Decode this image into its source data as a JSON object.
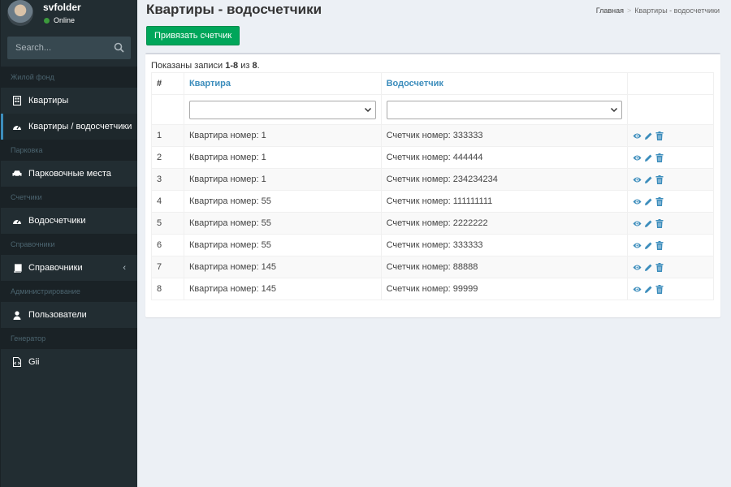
{
  "user": {
    "name": "svfolder",
    "status": "Online"
  },
  "search": {
    "placeholder": "Search..."
  },
  "menu": {
    "header_housing": "Жилой фонд",
    "item_flats": "Квартиры",
    "item_flats_meters": "Квартиры / водосчетчики",
    "header_parking": "Парковка",
    "item_parking": "Парковочные места",
    "header_meters": "Счетчики",
    "item_meters": "Водосчетчики",
    "header_refs": "Справочники",
    "item_refs": "Справочники",
    "header_admin": "Администрирование",
    "item_users": "Пользователи",
    "header_gen": "Генератор",
    "item_gii": "Gii"
  },
  "page": {
    "title": "Квартиры - водосчетчики",
    "breadcrumb_home": "Главная",
    "breadcrumb_sep": ">",
    "breadcrumb_current": "Квартиры - водосчетчики",
    "bind_button": "Привязать счетчик"
  },
  "summary": {
    "prefix": "Показаны записи ",
    "range": "1-8",
    "of": " из ",
    "total": "8",
    "suffix": "."
  },
  "table": {
    "headers": {
      "num": "#",
      "flat": "Квартира",
      "meter": "Водосчетчик"
    },
    "rows": [
      {
        "num": "1",
        "flat": "Квартира номер: 1",
        "meter": "Счетчик номер: 333333"
      },
      {
        "num": "2",
        "flat": "Квартира номер: 1",
        "meter": "Счетчик номер: 444444"
      },
      {
        "num": "3",
        "flat": "Квартира номер: 1",
        "meter": "Счетчик номер: 234234234"
      },
      {
        "num": "4",
        "flat": "Квартира номер: 55",
        "meter": "Счетчик номер: 111111111"
      },
      {
        "num": "5",
        "flat": "Квартира номер: 55",
        "meter": "Счетчик номер: 2222222"
      },
      {
        "num": "6",
        "flat": "Квартира номер: 55",
        "meter": "Счетчик номер: 333333"
      },
      {
        "num": "7",
        "flat": "Квартира номер: 145",
        "meter": "Счетчик номер: 88888"
      },
      {
        "num": "8",
        "flat": "Квартира номер: 145",
        "meter": "Счетчик номер: 99999"
      }
    ]
  },
  "colors": {
    "sidebar": "#222d32",
    "accent": "#3c8dbc",
    "success": "#00a65a",
    "background": "#ecf0f5"
  },
  "icons": {
    "view": "eye-icon",
    "edit": "pencil-icon",
    "delete": "trash-icon"
  }
}
